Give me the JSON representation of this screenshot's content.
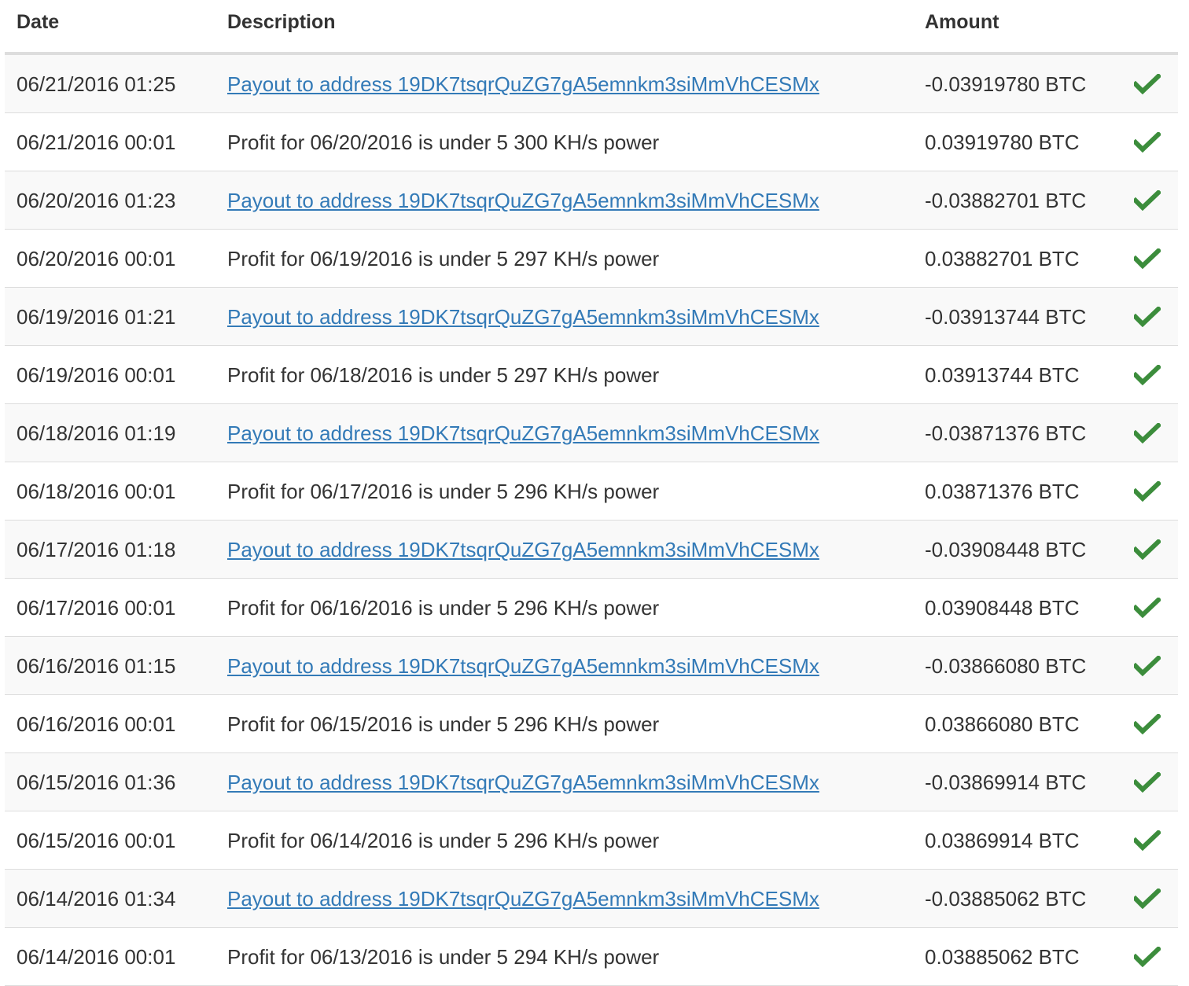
{
  "table": {
    "headers": {
      "date": "Date",
      "description": "Description",
      "amount": "Amount"
    },
    "check_color": "#3c8d3c",
    "link_color": "#337ab7",
    "rows": [
      {
        "date": "06/21/2016 01:25",
        "description": "Payout to address 19DK7tsqrQuZG7gA5emnkm3siMmVhCESMx",
        "is_link": true,
        "amount": "-0.03919780 BTC",
        "status_icon": "checkmark-icon"
      },
      {
        "date": "06/21/2016 00:01",
        "description": "Profit for 06/20/2016 is under 5 300 KH/s power",
        "is_link": false,
        "amount": "0.03919780 BTC",
        "status_icon": "checkmark-icon"
      },
      {
        "date": "06/20/2016 01:23",
        "description": "Payout to address 19DK7tsqrQuZG7gA5emnkm3siMmVhCESMx",
        "is_link": true,
        "amount": "-0.03882701 BTC",
        "status_icon": "checkmark-icon"
      },
      {
        "date": "06/20/2016 00:01",
        "description": "Profit for 06/19/2016 is under 5 297 KH/s power",
        "is_link": false,
        "amount": "0.03882701 BTC",
        "status_icon": "checkmark-icon"
      },
      {
        "date": "06/19/2016 01:21",
        "description": "Payout to address 19DK7tsqrQuZG7gA5emnkm3siMmVhCESMx",
        "is_link": true,
        "amount": "-0.03913744 BTC",
        "status_icon": "checkmark-icon"
      },
      {
        "date": "06/19/2016 00:01",
        "description": "Profit for 06/18/2016 is under 5 297 KH/s power",
        "is_link": false,
        "amount": "0.03913744 BTC",
        "status_icon": "checkmark-icon"
      },
      {
        "date": "06/18/2016 01:19",
        "description": "Payout to address 19DK7tsqrQuZG7gA5emnkm3siMmVhCESMx",
        "is_link": true,
        "amount": "-0.03871376 BTC",
        "status_icon": "checkmark-icon"
      },
      {
        "date": "06/18/2016 00:01",
        "description": "Profit for 06/17/2016 is under 5 296 KH/s power",
        "is_link": false,
        "amount": "0.03871376 BTC",
        "status_icon": "checkmark-icon"
      },
      {
        "date": "06/17/2016 01:18",
        "description": "Payout to address 19DK7tsqrQuZG7gA5emnkm3siMmVhCESMx",
        "is_link": true,
        "amount": "-0.03908448 BTC",
        "status_icon": "checkmark-icon"
      },
      {
        "date": "06/17/2016 00:01",
        "description": "Profit for 06/16/2016 is under 5 296 KH/s power",
        "is_link": false,
        "amount": "0.03908448 BTC",
        "status_icon": "checkmark-icon"
      },
      {
        "date": "06/16/2016 01:15",
        "description": "Payout to address 19DK7tsqrQuZG7gA5emnkm3siMmVhCESMx",
        "is_link": true,
        "amount": "-0.03866080 BTC",
        "status_icon": "checkmark-icon"
      },
      {
        "date": "06/16/2016 00:01",
        "description": "Profit for 06/15/2016 is under 5 296 KH/s power",
        "is_link": false,
        "amount": "0.03866080 BTC",
        "status_icon": "checkmark-icon"
      },
      {
        "date": "06/15/2016 01:36",
        "description": "Payout to address 19DK7tsqrQuZG7gA5emnkm3siMmVhCESMx",
        "is_link": true,
        "amount": "-0.03869914 BTC",
        "status_icon": "checkmark-icon"
      },
      {
        "date": "06/15/2016 00:01",
        "description": "Profit for 06/14/2016 is under 5 296 KH/s power",
        "is_link": false,
        "amount": "0.03869914 BTC",
        "status_icon": "checkmark-icon"
      },
      {
        "date": "06/14/2016 01:34",
        "description": "Payout to address 19DK7tsqrQuZG7gA5emnkm3siMmVhCESMx",
        "is_link": true,
        "amount": "-0.03885062 BTC",
        "status_icon": "checkmark-icon"
      },
      {
        "date": "06/14/2016 00:01",
        "description": "Profit for 06/13/2016 is under 5 294 KH/s power",
        "is_link": false,
        "amount": "0.03885062 BTC",
        "status_icon": "checkmark-icon"
      }
    ]
  }
}
